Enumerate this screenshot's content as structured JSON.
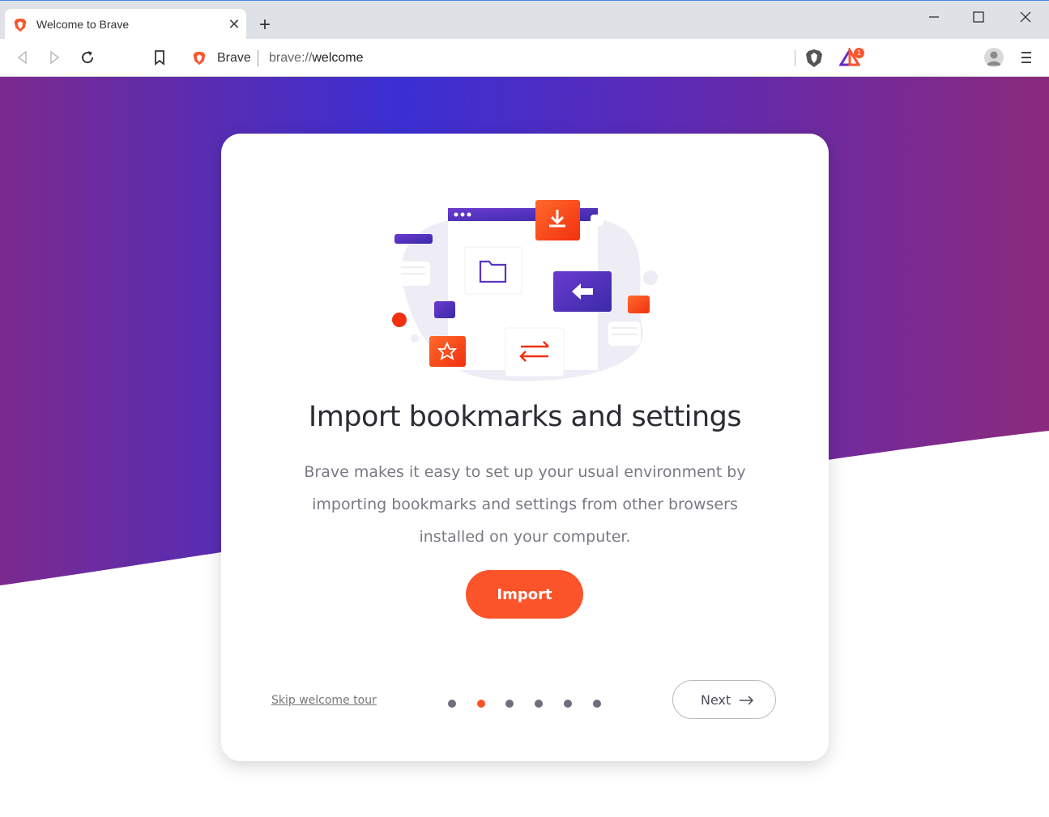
{
  "tab": {
    "title": "Welcome to Brave",
    "favicon": "brave-lion-icon"
  },
  "omnibox": {
    "site_name": "Brave",
    "url_scheme": "brave://",
    "url_path": "welcome"
  },
  "rewards": {
    "badge_count": "1"
  },
  "card": {
    "title": "Import bookmarks and settings",
    "description": "Brave makes it easy to set up your usual environment by importing bookmarks and settings from other browsers installed on your computer.",
    "primary_button": "Import",
    "skip_link": "Skip welcome tour",
    "next_button": "Next"
  },
  "pagination": {
    "total": 6,
    "current": 2
  },
  "colors": {
    "brand_orange": "#fb542b",
    "gradient_purple": "#7b2a8e",
    "gradient_blue": "#3b2fd3",
    "chrome_gray": "#dee1e6"
  }
}
